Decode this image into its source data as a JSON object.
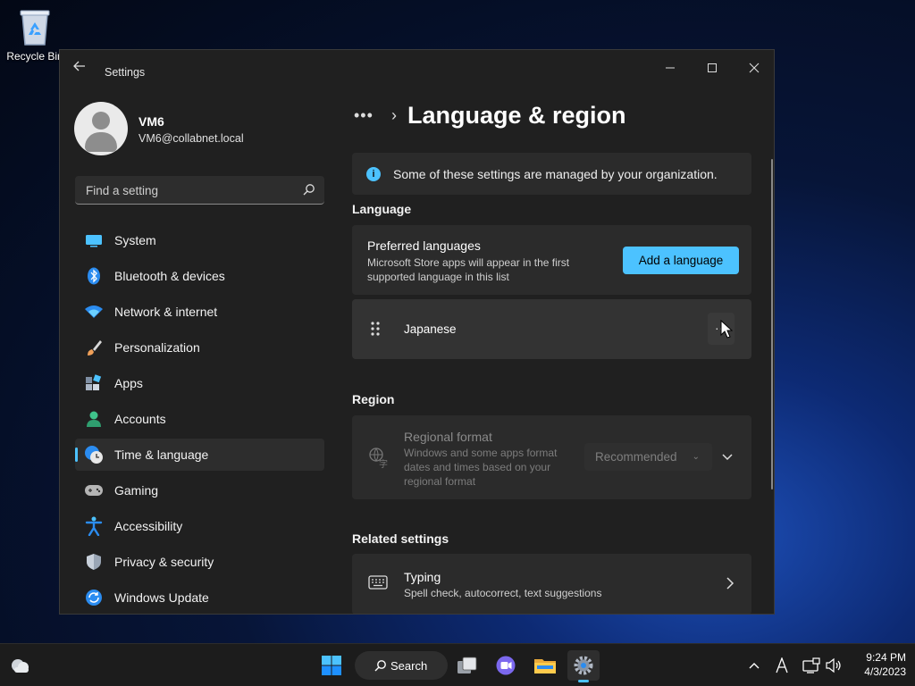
{
  "desktop": {
    "recycle_bin_label": "Recycle Bin"
  },
  "window": {
    "title": "Settings",
    "controls": {
      "minimize": "—",
      "maximize": "☐",
      "close": "✕"
    }
  },
  "profile": {
    "name": "VM6",
    "email": "VM6@collabnet.local"
  },
  "search": {
    "placeholder": "Find a setting"
  },
  "nav": {
    "items": [
      {
        "label": "System",
        "icon": "system-icon",
        "color": "#4cc2ff"
      },
      {
        "label": "Bluetooth & devices",
        "icon": "bluetooth-icon",
        "color": "#2b8cf0"
      },
      {
        "label": "Network & internet",
        "icon": "wifi-icon",
        "color": "#2b8cf0"
      },
      {
        "label": "Personalization",
        "icon": "brush-icon",
        "color": "#f0a058"
      },
      {
        "label": "Apps",
        "icon": "apps-icon",
        "color": "#9aa6b5"
      },
      {
        "label": "Accounts",
        "icon": "accounts-icon",
        "color": "#3fc38b"
      },
      {
        "label": "Time & language",
        "icon": "clock-globe-icon",
        "color": "#4cc2ff",
        "active": true
      },
      {
        "label": "Gaming",
        "icon": "gamepad-icon",
        "color": "#b5b5b5"
      },
      {
        "label": "Accessibility",
        "icon": "accessibility-icon",
        "color": "#2b8cf0"
      },
      {
        "label": "Privacy & security",
        "icon": "shield-icon",
        "color": "#9aa6b5"
      },
      {
        "label": "Windows Update",
        "icon": "update-icon",
        "color": "#2b8cf0"
      }
    ]
  },
  "breadcrumb": {
    "overflow": "•••",
    "separator": "›",
    "title": "Language & region"
  },
  "info_bar": {
    "text": "Some of these settings are managed by your organization."
  },
  "language": {
    "section_label": "Language",
    "preferred": {
      "title": "Preferred languages",
      "description": "Microsoft Store apps will appear in the first supported language in this list",
      "button": "Add a language"
    },
    "entries": [
      {
        "name": "Japanese",
        "more": "···"
      }
    ]
  },
  "region": {
    "section_label": "Region",
    "format": {
      "title": "Regional format",
      "description": "Windows and some apps format dates and times based on your regional format",
      "value": "Recommended"
    }
  },
  "related": {
    "section_label": "Related settings",
    "typing": {
      "title": "Typing",
      "description": "Spell check, autocorrect, text suggestions"
    }
  },
  "taskbar": {
    "search_label": "Search",
    "time": "9:24 PM",
    "date": "4/3/2023",
    "accent": "#4cc2ff"
  }
}
